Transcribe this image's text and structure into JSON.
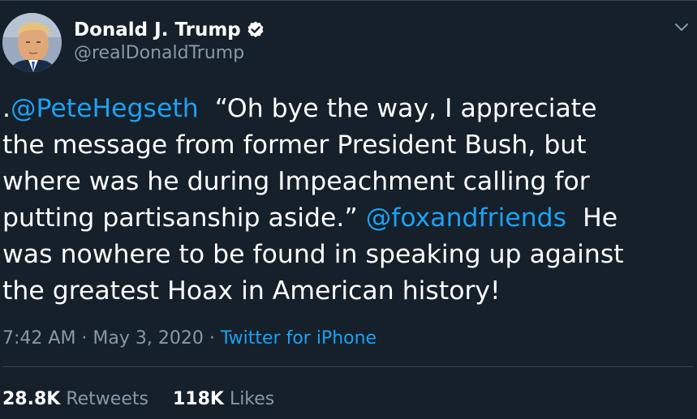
{
  "author": {
    "display_name": "Donald J. Trump",
    "handle": "@realDonaldTrump",
    "verified": true,
    "avatar_icon": "profile-photo"
  },
  "tweet": {
    "lines": [
      [
        {
          "text": ".",
          "type": "text"
        },
        {
          "text": "@PeteHegseth",
          "type": "mention"
        },
        {
          "text": "  “Oh bye the way, I appreciate",
          "type": "text"
        }
      ],
      [
        {
          "text": "the message from former President Bush, but",
          "type": "text"
        }
      ],
      [
        {
          "text": "where was he during Impeachment calling for",
          "type": "text"
        }
      ],
      [
        {
          "text": "putting partisanship aside.” ",
          "type": "text"
        },
        {
          "text": "@foxandfriends",
          "type": "mention"
        },
        {
          "text": "  He",
          "type": "text"
        }
      ],
      [
        {
          "text": "was nowhere to be found in speaking up against",
          "type": "text"
        }
      ],
      [
        {
          "text": "the greatest Hoax in American history!",
          "type": "text"
        }
      ]
    ]
  },
  "meta": {
    "time": "7:42 AM",
    "separator": " · ",
    "date": "May 3, 2020",
    "source": "Twitter for iPhone"
  },
  "stats": {
    "retweets_count": "28.8K",
    "retweets_label": "Retweets",
    "likes_count": "118K",
    "likes_label": "Likes"
  },
  "colors": {
    "background": "#15202b",
    "link": "#1da1f2",
    "secondary_text": "#8899a6",
    "divider": "#38444d"
  }
}
